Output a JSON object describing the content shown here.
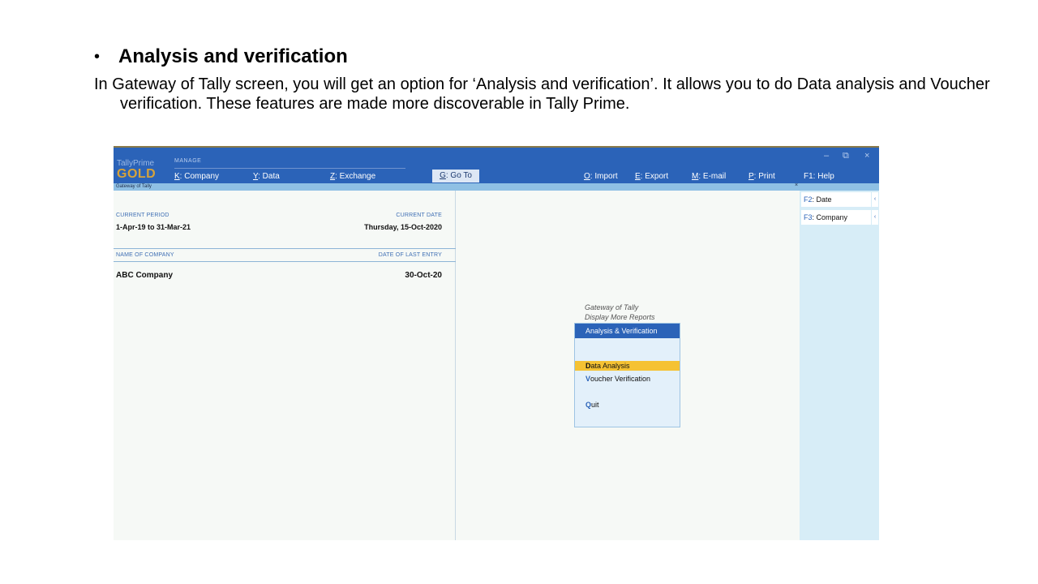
{
  "slide": {
    "bullet": "•",
    "heading": "Analysis and verification",
    "paragraph": "In Gateway of Tally screen, you will get an option for ‘Analysis and verification’. It allows you to do Data analysis and Voucher verification. These features are made more discoverable in Tally Prime."
  },
  "app": {
    "brand_name": "TallyPrime",
    "brand_edition": "GOLD",
    "manage_label": "MANAGE",
    "window_controls": {
      "minimize": "–",
      "restore": "⧉",
      "close": "×"
    }
  },
  "menubar": {
    "items": [
      {
        "key": "K",
        "label": ": Company"
      },
      {
        "key": "Y",
        "label": ": Data"
      },
      {
        "key": "Z",
        "label": ": Exchange"
      },
      {
        "key": "G",
        "label": ": Go To"
      },
      {
        "key": "O",
        "label": ": Import"
      },
      {
        "key": "E",
        "label": ": Export"
      },
      {
        "key": "M",
        "label": ": E-mail"
      },
      {
        "key": "P",
        "label": ": Print"
      },
      {
        "key": "F1",
        "label": ": Help"
      }
    ]
  },
  "screen": {
    "title": "Gateway of Tally",
    "close": "×"
  },
  "info": {
    "current_period_label": "CURRENT PERIOD",
    "current_period_value": "1-Apr-19 to 31-Mar-21",
    "current_date_label": "CURRENT DATE",
    "current_date_value": "Thursday, 15-Oct-2020",
    "company_label": "NAME OF COMPANY",
    "last_entry_label": "DATE OF LAST ENTRY",
    "company_name": "ABC Company",
    "last_entry_date": "30-Oct-20"
  },
  "side_panel": {
    "buttons": [
      {
        "key": "F2",
        "label": ": Date",
        "arrow": "‹"
      },
      {
        "key": "F3",
        "label": ": Company",
        "arrow": "‹"
      }
    ]
  },
  "menu": {
    "caption1": "Gateway of Tally",
    "caption2": "Display More Reports",
    "title": "Analysis & Verification",
    "items": [
      {
        "hotkey": "D",
        "rest": "ata Analysis"
      },
      {
        "hotkey": "V",
        "rest": "oucher Verification"
      },
      {
        "hotkey": "Q",
        "rest": "uit"
      }
    ]
  },
  "colors": {
    "topbar": "#2b63b8",
    "gold": "#d6a33b",
    "highlight": "#f5c233",
    "side_panel": "#d7edf7"
  }
}
